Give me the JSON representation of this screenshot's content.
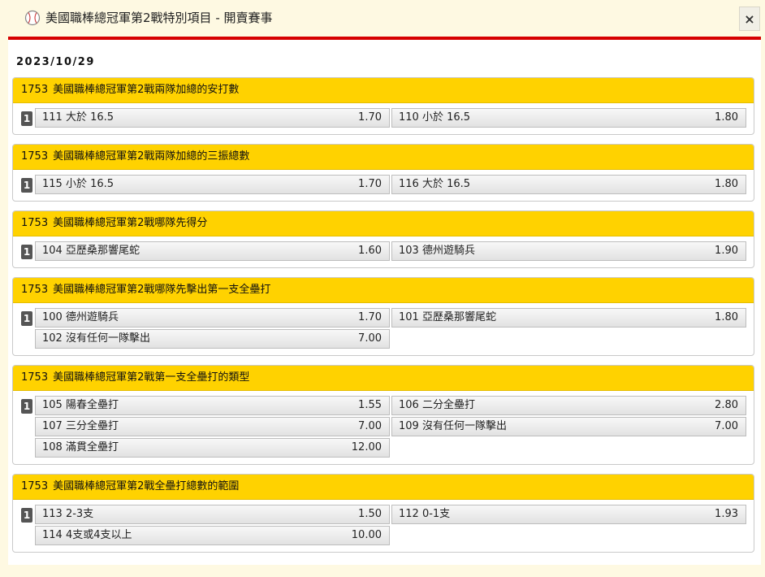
{
  "window": {
    "title": "美國職棒總冠軍第2戰特別項目 - 開賣賽事",
    "icon": "baseball-icon",
    "close_label": "×"
  },
  "date": "2023/10/29",
  "markets": [
    {
      "code": "1753",
      "name": "美國職棒總冠軍第2戰兩隊加總的安打數",
      "badge": "1",
      "selections": [
        {
          "name": "111 大於 16.5",
          "odds": "1.70"
        },
        {
          "name": "110 小於 16.5",
          "odds": "1.80"
        }
      ]
    },
    {
      "code": "1753",
      "name": "美國職棒總冠軍第2戰兩隊加總的三振總數",
      "badge": "1",
      "selections": [
        {
          "name": "115 小於 16.5",
          "odds": "1.70"
        },
        {
          "name": "116 大於 16.5",
          "odds": "1.80"
        }
      ]
    },
    {
      "code": "1753",
      "name": "美國職棒總冠軍第2戰哪隊先得分",
      "badge": "1",
      "selections": [
        {
          "name": "104 亞歷桑那響尾蛇",
          "odds": "1.60"
        },
        {
          "name": "103 德州遊騎兵",
          "odds": "1.90"
        }
      ]
    },
    {
      "code": "1753",
      "name": "美國職棒總冠軍第2戰哪隊先擊出第一支全壘打",
      "badge": "1",
      "selections": [
        {
          "name": "100 德州遊騎兵",
          "odds": "1.70"
        },
        {
          "name": "101 亞歷桑那響尾蛇",
          "odds": "1.80"
        },
        {
          "name": "102 沒有任何一隊擊出",
          "odds": "7.00"
        }
      ]
    },
    {
      "code": "1753",
      "name": "美國職棒總冠軍第2戰第一支全壘打的類型",
      "badge": "1",
      "selections": [
        {
          "name": "105 陽春全壘打",
          "odds": "1.55"
        },
        {
          "name": "106 二分全壘打",
          "odds": "2.80"
        },
        {
          "name": "107 三分全壘打",
          "odds": "7.00"
        },
        {
          "name": "109 沒有任何一隊擊出",
          "odds": "7.00"
        },
        {
          "name": "108 滿貫全壘打",
          "odds": "12.00"
        }
      ]
    },
    {
      "code": "1753",
      "name": "美國職棒總冠軍第2戰全壘打總數的範圍",
      "badge": "1",
      "selections": [
        {
          "name": "113 2-3支",
          "odds": "1.50"
        },
        {
          "name": "112 0-1支",
          "odds": "1.93"
        },
        {
          "name": "114 4支或4支以上",
          "odds": "10.00"
        }
      ]
    }
  ]
}
